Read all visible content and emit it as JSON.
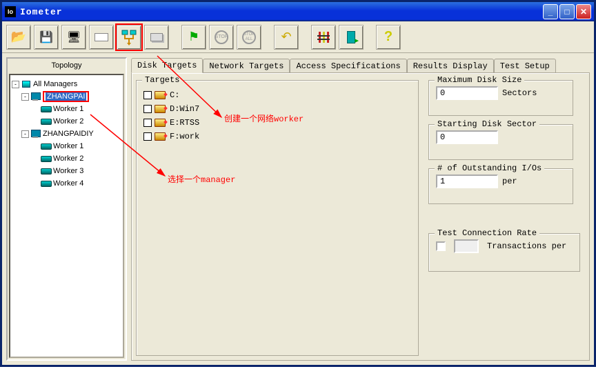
{
  "window": {
    "title": "Iometer"
  },
  "toolbar": {
    "buttons": [
      {
        "name": "open",
        "glyph": "📂"
      },
      {
        "name": "save",
        "glyph": "💾"
      },
      {
        "name": "new-manager",
        "glyph": "🖥"
      },
      {
        "name": "new-disk-worker",
        "glyph": "▭"
      },
      {
        "name": "new-network-worker",
        "glyph": "▼",
        "highlight": true
      },
      {
        "name": "duplicate-worker",
        "glyph": "⧉"
      },
      {
        "sep": true
      },
      {
        "name": "start",
        "glyph": "🚩"
      },
      {
        "name": "stop",
        "glyph": "STOP"
      },
      {
        "name": "stop-all",
        "glyph": "STOP\nALL"
      },
      {
        "sep": true
      },
      {
        "name": "reset",
        "glyph": "↩"
      },
      {
        "sep": true
      },
      {
        "name": "spec",
        "glyph": "≡"
      },
      {
        "name": "exit",
        "glyph": "🚪"
      },
      {
        "sep": true
      },
      {
        "name": "help",
        "glyph": "?"
      }
    ]
  },
  "topology": {
    "header": "Topology",
    "root": "All Managers",
    "managers": [
      {
        "name": "ZHANGPAI",
        "selected": true,
        "highlight": true,
        "workers": [
          "Worker 1",
          "Worker 2"
        ]
      },
      {
        "name": "ZHANGPAIDIY",
        "selected": false,
        "workers": [
          "Worker 1",
          "Worker 2",
          "Worker 3",
          "Worker 4"
        ]
      }
    ]
  },
  "tabs": {
    "items": [
      "Disk Targets",
      "Network Targets",
      "Access Specifications",
      "Results Display",
      "Test Setup"
    ],
    "active": 0
  },
  "targets": {
    "legend": "Targets",
    "drives": [
      {
        "label": "C:"
      },
      {
        "label": "D:Win7"
      },
      {
        "label": "E:RTSS"
      },
      {
        "label": "F:work"
      }
    ]
  },
  "maxDisk": {
    "legend": "Maximum Disk Size",
    "value": "0",
    "unit": "Sectors"
  },
  "startSector": {
    "legend": "Starting Disk Sector",
    "value": "0"
  },
  "outstanding": {
    "legend": "# of Outstanding I/Os",
    "value": "1",
    "unit": "per"
  },
  "connRate": {
    "legend": "Test Connection Rate",
    "unit": "Transactions per"
  },
  "annotations": {
    "a1": "创建一个网络worker",
    "a2": "选择一个manager"
  }
}
